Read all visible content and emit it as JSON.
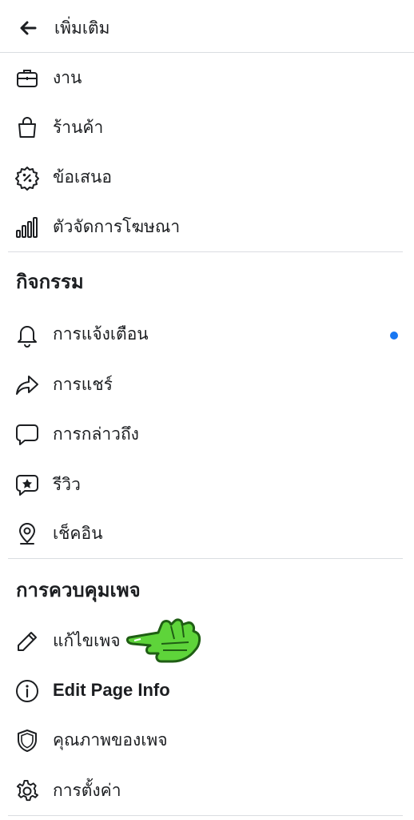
{
  "header": {
    "title": "เพิ่มเติม",
    "back_icon": "arrow-left-icon"
  },
  "top_items": [
    {
      "label": "งาน",
      "icon": "briefcase-icon"
    },
    {
      "label": "ร้านค้า",
      "icon": "shopping-bag-icon"
    },
    {
      "label": "ข้อเสนอ",
      "icon": "percent-badge-icon"
    },
    {
      "label": "ตัวจัดการโฆษณา",
      "icon": "bar-chart-icon"
    }
  ],
  "activity": {
    "title": "กิจกรรม",
    "items": [
      {
        "label": "การแจ้งเตือน",
        "icon": "bell-icon",
        "has_unread_dot": true
      },
      {
        "label": "การแชร์",
        "icon": "share-icon"
      },
      {
        "label": "การกล่าวถึง",
        "icon": "speech-bubble-icon"
      },
      {
        "label": "รีวิว",
        "icon": "star-bubble-icon"
      },
      {
        "label": "เช็คอิน",
        "icon": "location-pin-icon"
      }
    ]
  },
  "page_control": {
    "title": "การควบคุมเพจ",
    "items": [
      {
        "label": "แก้ไขเพจ",
        "icon": "pencil-icon"
      },
      {
        "label": "Edit Page Info",
        "icon": "info-circle-icon"
      },
      {
        "label": "คุณภาพของเพจ",
        "icon": "shield-icon"
      },
      {
        "label": "การตั้งค่า",
        "icon": "gear-icon"
      }
    ]
  },
  "colors": {
    "text": "#1c1e21",
    "divider": "#dadde1",
    "accent_dot": "#1877f2",
    "hand_green": "#5ed43a"
  }
}
